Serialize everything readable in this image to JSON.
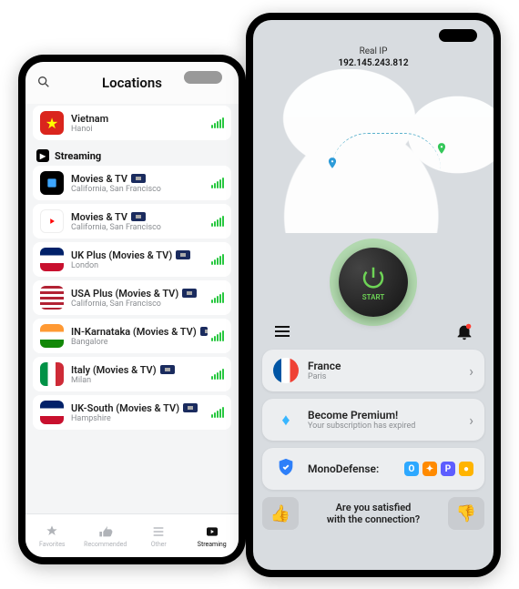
{
  "left": {
    "title": "Locations",
    "rows": [
      {
        "name": "Vietnam",
        "sub": "Hanoi",
        "flag": "vn"
      }
    ],
    "section": "Streaming",
    "streaming": [
      {
        "name": "Movies & TV",
        "sub": "California, San Francisco",
        "flag": "app-blue",
        "tag": true
      },
      {
        "name": "Movies & TV",
        "sub": "California, San Francisco",
        "flag": "app-red",
        "tag": true
      },
      {
        "name": "UK Plus (Movies & TV)",
        "sub": "London",
        "flag": "uk",
        "tag": true
      },
      {
        "name": "USA Plus (Movies & TV)",
        "sub": "California, San Francisco",
        "flag": "us",
        "tag": true
      },
      {
        "name": "IN-Karnataka (Movies & TV)",
        "sub": "Bangalore",
        "flag": "in",
        "tag": true
      },
      {
        "name": "Italy (Movies & TV)",
        "sub": "Milan",
        "flag": "it",
        "tag": true
      },
      {
        "name": "UK-South (Movies & TV)",
        "sub": "Hampshire",
        "flag": "uk",
        "tag": true
      }
    ],
    "tabs": [
      "Favorites",
      "Recommended",
      "Other",
      "Streaming"
    ],
    "activeTab": 3
  },
  "right": {
    "ipLabel": "Real IP",
    "ip": "192.145.243.812",
    "powerLabel": "START",
    "country": {
      "name": "France",
      "sub": "Paris"
    },
    "premium": {
      "title": "Become Premium!",
      "sub": "Your subscription has expired"
    },
    "defense": {
      "title": "MonoDefense:"
    },
    "feedback": "Are you satisfied\nwith the connection?"
  }
}
